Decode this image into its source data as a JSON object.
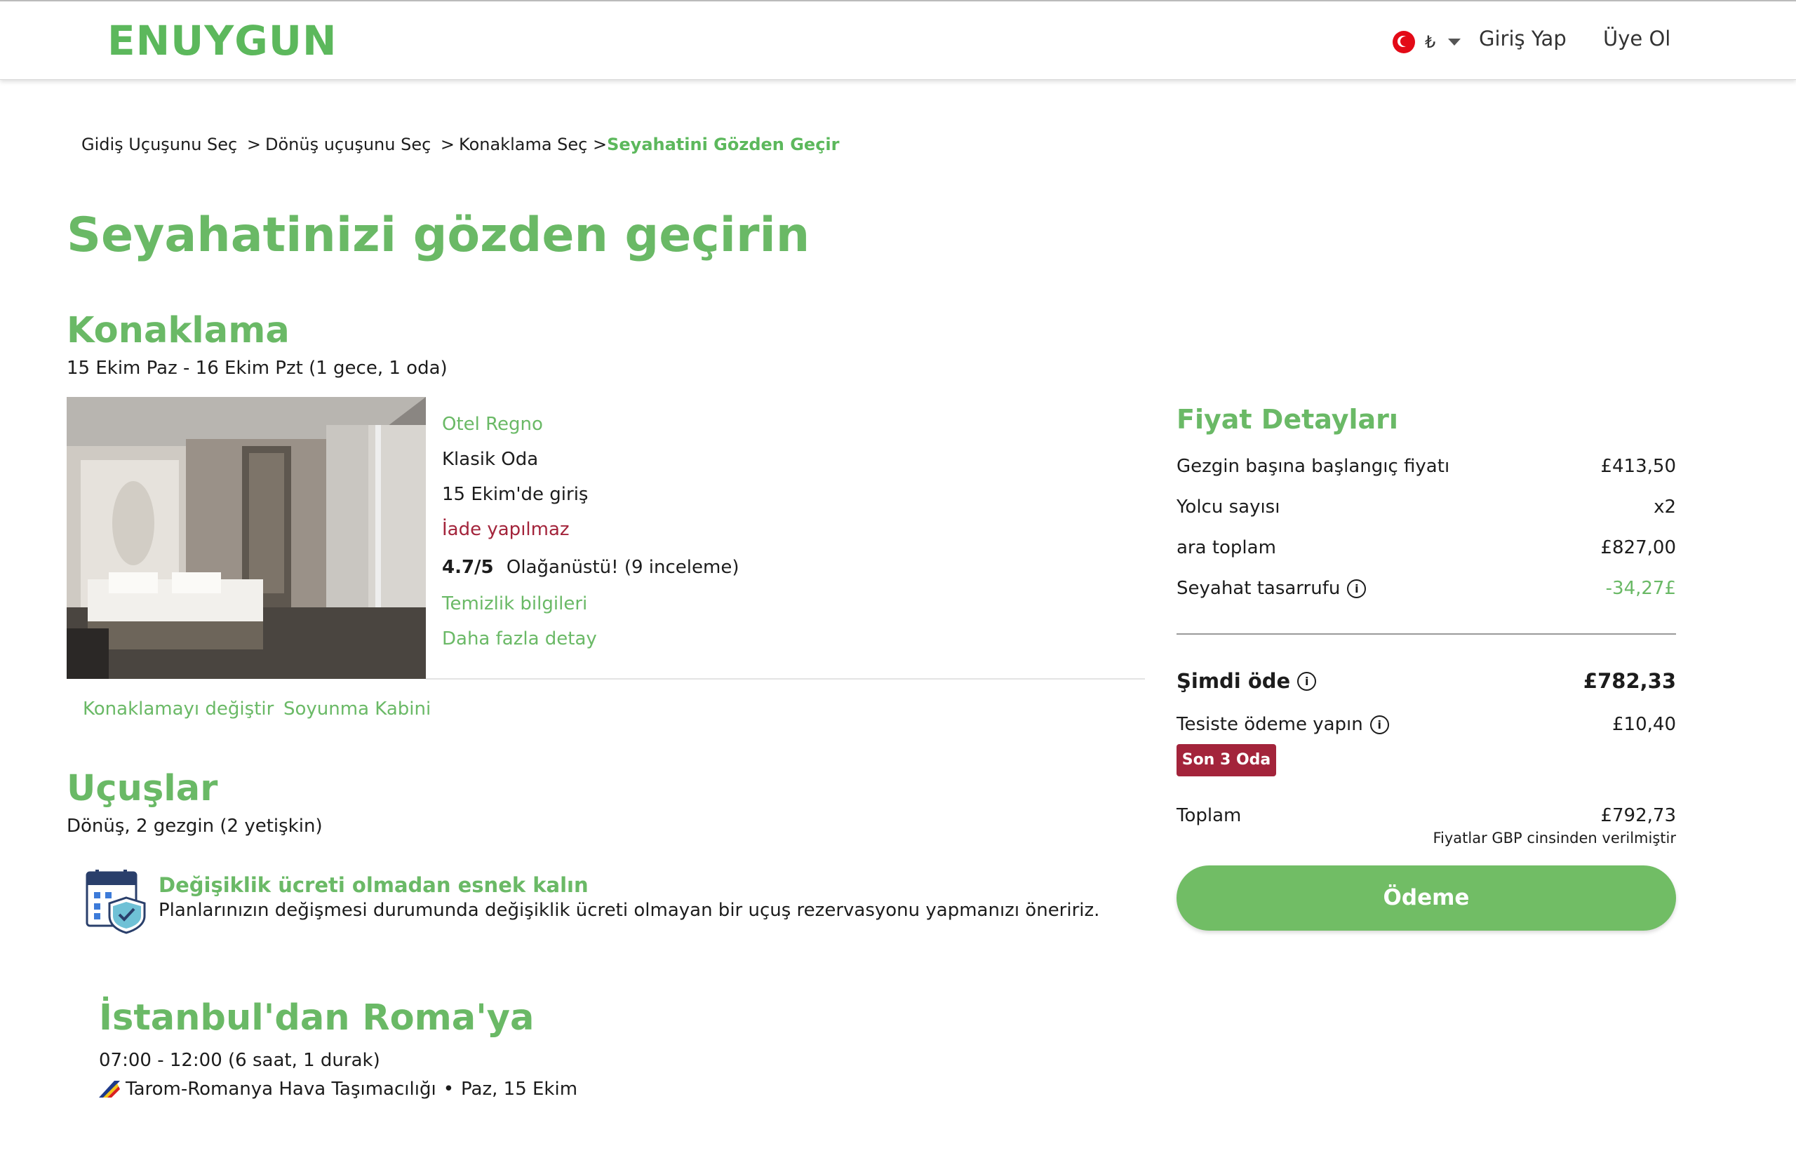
{
  "header": {
    "logo": "ENUYGUN",
    "currency_symbol": "₺",
    "login": "Giriş Yap",
    "signup": "Üye Ol"
  },
  "breadcrumb": {
    "step1": "Gidiş Uçuşunu Seç",
    "step2": "Dönüş uçuşunu Seç",
    "step3": "Konaklama Seç",
    "step4": "Seyahatini Gözden Geçir",
    "separator": ">"
  },
  "page_title": "Seyahatinizi gözden geçirin",
  "accommodation": {
    "title": "Konaklama",
    "dates": "15 Ekim Paz - 16 Ekim Pzt (1 gece, 1 oda)",
    "hotel_name": "Otel Regno",
    "room_type": "Klasik Oda",
    "checkin": "15 Ekim'de giriş",
    "refund": "İade yapılmaz",
    "rating": "4.7/5",
    "rating_text": "Olağanüstü! (9 inceleme)",
    "cleaning_link": "Temizlik bilgileri",
    "details_link": "Daha fazla detay",
    "change_link": "Konaklamayı değiştir",
    "changing_room_link": "Soyunma Kabini"
  },
  "flights": {
    "title": "Uçuşlar",
    "subtitle": "Dönüş, 2 gezgin (2 yetişkin)",
    "notice_title": "Değişiklik ücreti olmadan esnek kalın",
    "notice_text": "Planlarınızın değişmesi durumunda değişiklik ücreti olmayan bir uçuş rezervasyonu yapmanızı öneririz.",
    "route_title": "İstanbul'dan Roma'ya",
    "route_time": "07:00 - 12:00 (6 saat, 1 durak)",
    "airline": "Tarom-Romanya Hava Taşımacılığı",
    "airline_sep": "•",
    "flight_date": "Paz, 15 Ekim"
  },
  "price": {
    "title": "Fiyat Detayları",
    "rows": [
      {
        "label": "Gezgin başına başlangıç fiyatı",
        "value": "£413,50"
      },
      {
        "label": "Yolcu sayısı",
        "value": "x2"
      },
      {
        "label": "ara toplam",
        "value": "£827,00"
      },
      {
        "label": "Seyahat tasarrufu",
        "value": "-34,27£"
      }
    ],
    "pay_now_label": "Şimdi öde",
    "pay_now_value": "£782,33",
    "pay_at_property_label": "Tesiste ödeme yapın",
    "pay_at_property_value": "£10,40",
    "badge": "Son 3 Oda",
    "total_label": "Toplam",
    "total_value": "£792,73",
    "currency_note": "Fiyatlar GBP cinsinden verilmiştir",
    "checkout_button": "Ödeme"
  },
  "colors": {
    "brand_green": "#6ab966",
    "alert_red": "#a3243b"
  }
}
